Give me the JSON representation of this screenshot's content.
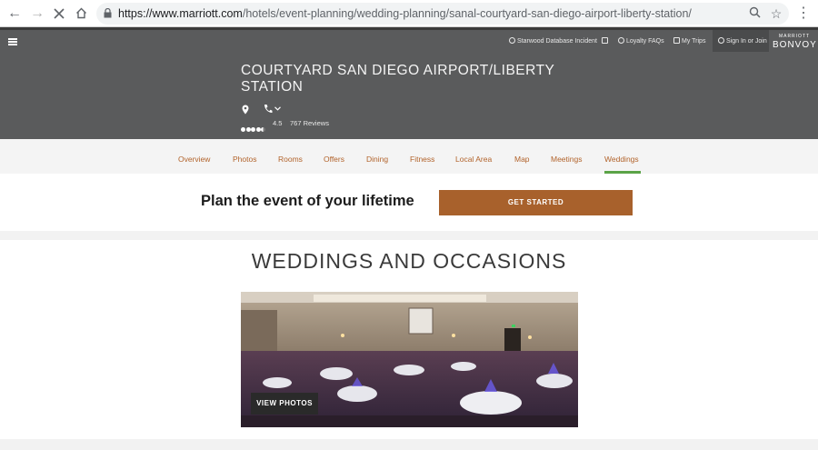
{
  "browser": {
    "url_host": "https://www.marriott.com",
    "url_path": "/hotels/event-planning/wedding-planning/sanal-courtyard-san-diego-airport-liberty-station/"
  },
  "utility_nav": {
    "starwood": "Starwood Database Incident",
    "loyalty": "Loyalty FAQs",
    "trips": "My Trips",
    "signin": "Sign In or Join",
    "brand_small": "MARRIOTT",
    "brand_big": "BONVOY"
  },
  "hotel": {
    "name": "COURTYARD SAN DIEGO AIRPORT/LIBERTY STATION",
    "rating": "4.5",
    "reviews": "767 Reviews",
    "rating_value": 4.5
  },
  "tabs": [
    "Overview",
    "Photos",
    "Rooms",
    "Offers",
    "Dining",
    "Fitness",
    "Local Area",
    "Map",
    "Meetings",
    "Weddings"
  ],
  "active_tab": "Weddings",
  "plan": {
    "headline": "Plan the event of your lifetime",
    "cta": "GET STARTED"
  },
  "section": {
    "title": "WEDDINGS AND OCCASIONS",
    "view_photos": "VIEW PHOTOS"
  },
  "colors": {
    "accent": "#a8612c",
    "tab_text": "#b2632b",
    "active_underline": "#5aa346",
    "header_bg": "#5a5b5c"
  }
}
